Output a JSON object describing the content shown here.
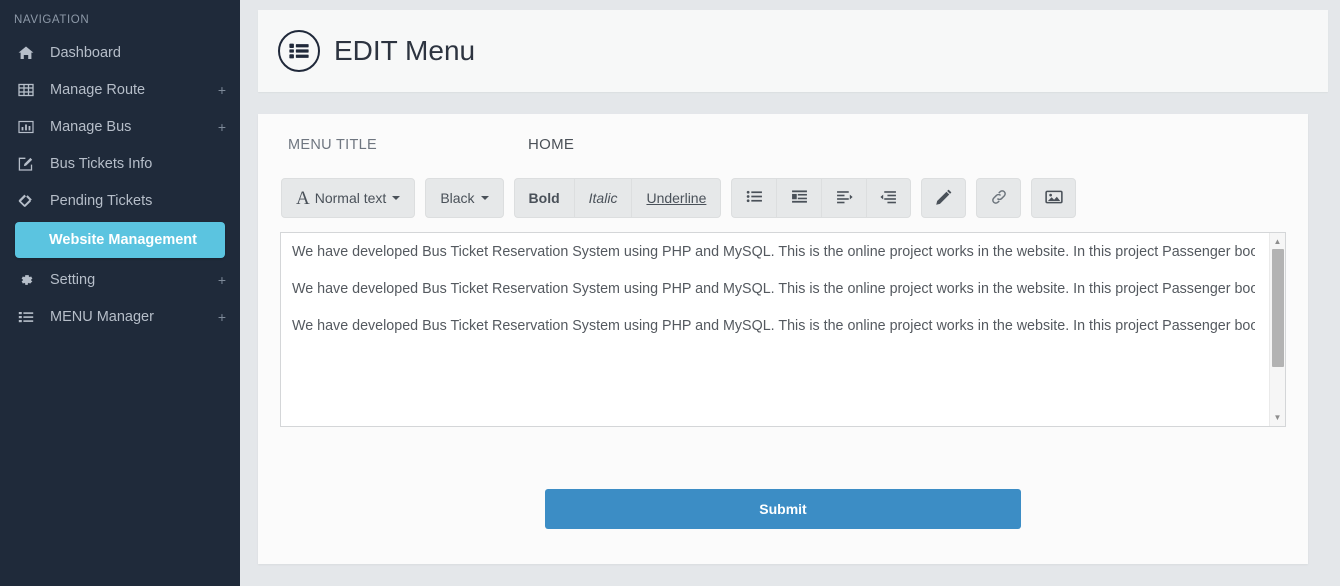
{
  "sidebar": {
    "heading": "NAVIGATION",
    "items": [
      {
        "label": "Dashboard",
        "icon": "home-icon",
        "expandable": false,
        "active": false
      },
      {
        "label": "Manage Route",
        "icon": "table-icon",
        "expandable": true,
        "active": false,
        "expand_symbol": "+"
      },
      {
        "label": "Manage Bus",
        "icon": "bar-chart-icon",
        "expandable": true,
        "active": false,
        "expand_symbol": "+"
      },
      {
        "label": "Bus Tickets Info",
        "icon": "edit-square-icon",
        "expandable": false,
        "active": false
      },
      {
        "label": "Pending Tickets",
        "icon": "tags-icon",
        "expandable": false,
        "active": false
      },
      {
        "label": "Website Management",
        "icon": "none",
        "expandable": false,
        "active": true
      },
      {
        "label": "Setting",
        "icon": "gear-icon",
        "expandable": true,
        "active": false,
        "expand_symbol": "+"
      },
      {
        "label": "MENU Manager",
        "icon": "list-icon",
        "expandable": true,
        "active": false,
        "expand_symbol": "+"
      }
    ]
  },
  "header": {
    "icon": "list-circle-icon",
    "title": "EDIT Menu"
  },
  "form": {
    "menu_title_label": "MENU TITLE",
    "menu_title_value": "HOME",
    "submit_label": "Submit"
  },
  "toolbar": {
    "style_select": {
      "label": "Normal text",
      "glyph": "A",
      "caret": "▼"
    },
    "color_select": {
      "label": "Black",
      "caret": "▼"
    },
    "bold_label": "Bold",
    "italic_label": "Italic",
    "underline_label": "Underline",
    "icons": [
      {
        "name": "unordered-list-icon"
      },
      {
        "name": "ordered-list-icon"
      },
      {
        "name": "indent-icon"
      },
      {
        "name": "outdent-icon"
      },
      {
        "name": "pencil-icon"
      },
      {
        "name": "link-icon"
      },
      {
        "name": "image-icon"
      }
    ]
  },
  "editor": {
    "paragraphs": [
      "We have developed Bus Ticket Reservation System using PHP and MySQL. This is the online project works in the website. In this project Passenger books the ticket and he pays through online. This project provides bus details, route information, seats details, billing details, ticket information, seat cancellation, etc",
      "We have developed Bus Ticket Reservation System using PHP and MySQL. This is the online project works in the website. In this project Passenger books the ticket and he pays through online. This project provides bus details, route information, seats details, billing details, ticket information, seat cancellation, etc",
      "We have developed Bus Ticket Reservation System using PHP and MySQL. This is the online project works in the website. In this project Passenger books the ticket and he pays through online. This project provides bus details, route information, seats details, billing details, ticket information, seat cancellation, etc"
    ],
    "scrollbar": {
      "up_arrow": "▲",
      "down_arrow": "▼"
    }
  },
  "colors": {
    "sidebar_bg": "#1f2a3a",
    "active_item": "#5bc4e0",
    "submit_button": "#3c8dc5",
    "page_bg": "#e4e7ea",
    "card_bg": "#fbfbfb"
  }
}
